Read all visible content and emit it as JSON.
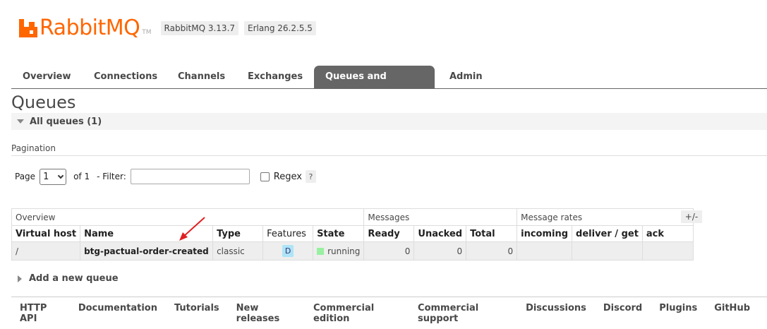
{
  "header": {
    "logo_text_a": "Rabbit",
    "logo_text_b": "MQ",
    "logo_tm": "TM",
    "version": "RabbitMQ 3.13.7",
    "erlang": "Erlang 26.2.5.5"
  },
  "tabs": [
    {
      "label": "Overview"
    },
    {
      "label": "Connections"
    },
    {
      "label": "Channels"
    },
    {
      "label": "Exchanges"
    },
    {
      "label": "Queues and Streams",
      "active": true
    },
    {
      "label": "Admin"
    }
  ],
  "page_title": "Queues",
  "section": {
    "label": "All queues (1)"
  },
  "pagination": {
    "label": "Pagination",
    "page_label": "Page",
    "page_value": "1",
    "of_text": "of 1",
    "filter_label": "- Filter:",
    "filter_value": "",
    "regex_label": "Regex",
    "help": "?"
  },
  "table": {
    "groups": [
      "Overview",
      "Messages",
      "Message rates"
    ],
    "columns": [
      "Virtual host",
      "Name",
      "Type",
      "Features",
      "State",
      "Ready",
      "Unacked",
      "Total",
      "incoming",
      "deliver / get",
      "ack"
    ],
    "rows": [
      {
        "vhost": "/",
        "name": "btg-pactual-order-created",
        "type": "classic",
        "feature": "D",
        "state": "running",
        "ready": "0",
        "unacked": "0",
        "total": "0",
        "incoming": "",
        "deliver_get": "",
        "ack": ""
      }
    ],
    "toggle": "+/-"
  },
  "add_queue": "Add a new queue",
  "footer": [
    "HTTP API",
    "Documentation",
    "Tutorials",
    "New releases",
    "Commercial edition",
    "Commercial support",
    "Discussions",
    "Discord",
    "Plugins",
    "GitHub"
  ],
  "colors": {
    "brand": "#ff6600",
    "active_tab": "#666666",
    "state_running": "#98f0a0",
    "feature_badge": "#aee4f7",
    "annotation_arrow": "#e02020"
  }
}
